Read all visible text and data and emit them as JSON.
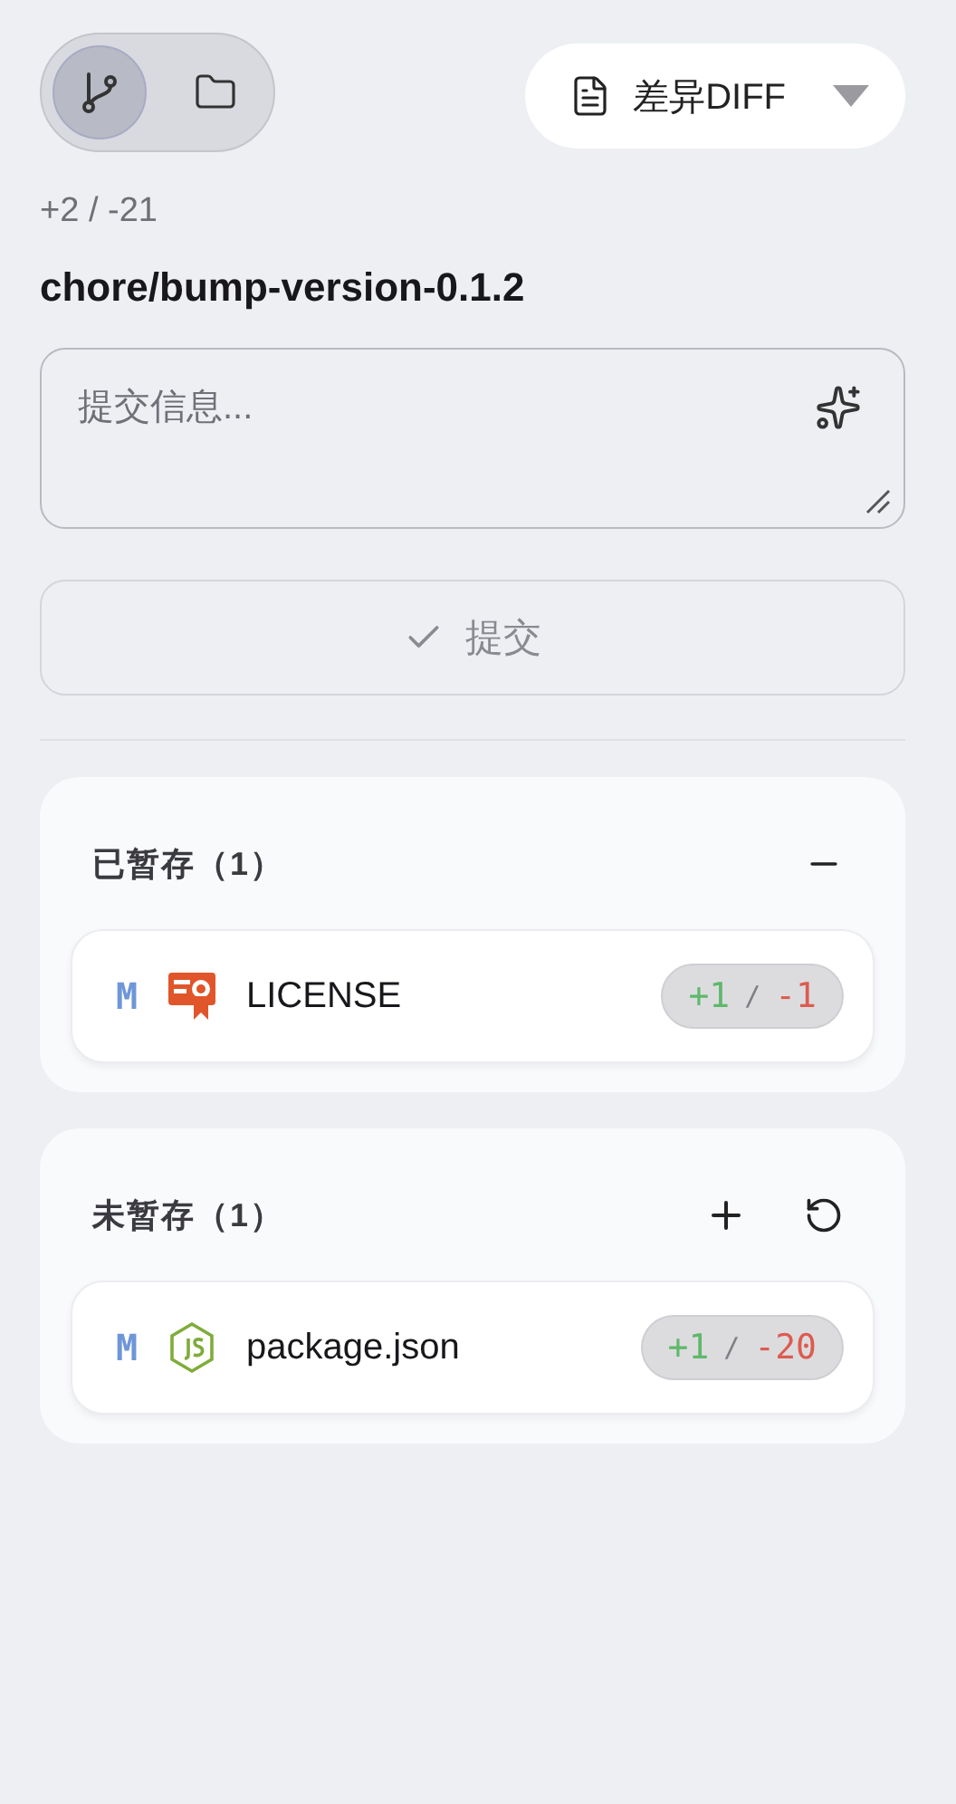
{
  "view_toggle": [
    {
      "kind": "branch",
      "selected": true
    },
    {
      "kind": "folder",
      "selected": false
    }
  ],
  "view_select": {
    "value": "差异DIFF"
  },
  "stats": "+2 / -21",
  "branch": "chore/bump-version-0.1.2",
  "message": {
    "placeholder": "提交信息..."
  },
  "commit_button": {
    "label": "提交",
    "disabled": true
  },
  "sections": [
    {
      "title": "已暂存（1）",
      "actions": [
        {
          "kind": "minus"
        }
      ],
      "files": [
        {
          "status": "M",
          "kind": "license",
          "name": "LICENSE",
          "added": "+1",
          "separator": "/",
          "removed": "-1"
        }
      ]
    },
    {
      "title": "未暂存（1）",
      "actions": [
        {
          "kind": "plus"
        },
        {
          "kind": "revert"
        }
      ],
      "files": [
        {
          "status": "M",
          "kind": "json",
          "name": "package.json",
          "added": "+1",
          "separator": "/",
          "removed": "-20"
        }
      ]
    }
  ]
}
